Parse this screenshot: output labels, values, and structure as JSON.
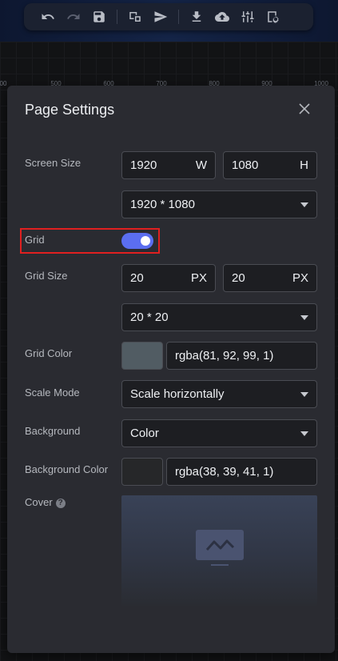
{
  "toolbar": {
    "buttons": [
      {
        "icon": "undo-icon",
        "enabled": true
      },
      {
        "icon": "redo-icon",
        "enabled": false
      },
      {
        "icon": "save-icon",
        "enabled": true
      },
      {
        "icon": "preview-icon",
        "enabled": true
      },
      {
        "icon": "publish-icon",
        "enabled": true
      },
      {
        "icon": "download-icon",
        "enabled": true
      },
      {
        "icon": "upload-cloud-icon",
        "enabled": true
      },
      {
        "icon": "sliders-icon",
        "enabled": true
      },
      {
        "icon": "page-settings-icon",
        "enabled": true
      }
    ]
  },
  "ruler": {
    "ticks": [
      "00",
      "500",
      "600",
      "700",
      "800",
      "900",
      "1000"
    ]
  },
  "dialog": {
    "title": "Page Settings",
    "screen_size": {
      "label": "Screen Size",
      "width": "1920",
      "width_unit": "W",
      "height": "1080",
      "height_unit": "H",
      "preset": "1920 * 1080"
    },
    "grid": {
      "label": "Grid",
      "enabled": true
    },
    "grid_size": {
      "label": "Grid Size",
      "x": "20",
      "x_unit": "PX",
      "y": "20",
      "y_unit": "PX",
      "preset": "20 * 20"
    },
    "grid_color": {
      "label": "Grid Color",
      "value": "rgba(81, 92, 99, 1)",
      "swatch": "#515c63"
    },
    "scale_mode": {
      "label": "Scale Mode",
      "value": "Scale horizontally"
    },
    "background": {
      "label": "Background",
      "value": "Color"
    },
    "background_color": {
      "label": "Background Color",
      "value": "rgba(38, 39, 41, 1)",
      "swatch": "#262729"
    },
    "cover": {
      "label": "Cover",
      "help": "?"
    }
  },
  "colors": {
    "accent": "#5b6ef0",
    "highlight": "#e02020"
  }
}
